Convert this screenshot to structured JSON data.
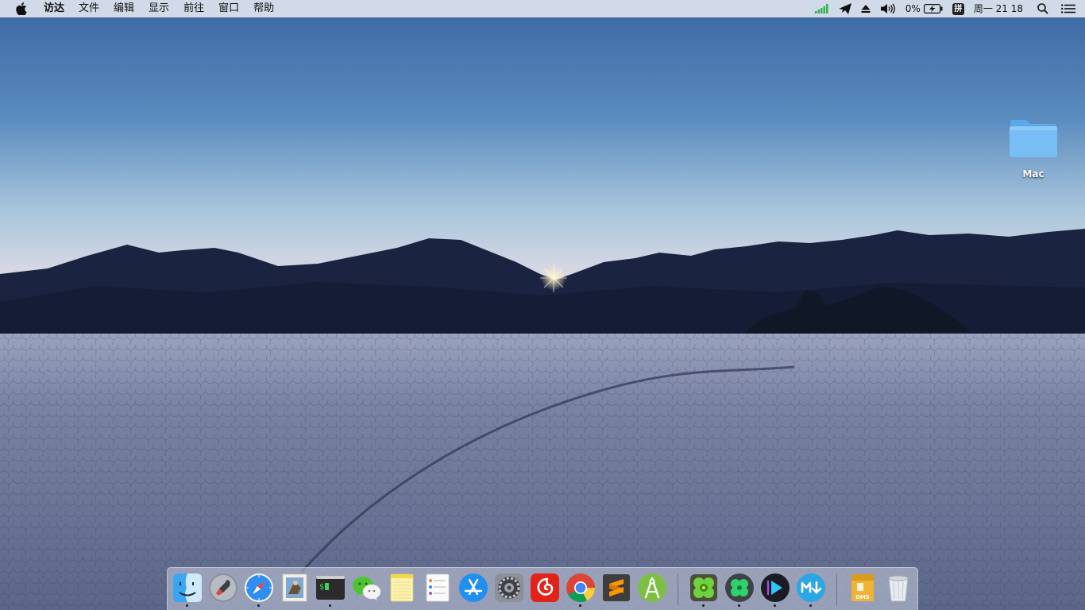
{
  "menubar": {
    "app_menu": "访达",
    "menus": [
      "文件",
      "编辑",
      "显示",
      "前往",
      "窗口",
      "帮助"
    ],
    "status": {
      "battery_percent": "0%",
      "input_method": "拼",
      "clock": "周一 21 18"
    }
  },
  "desktop": {
    "folder_label": "Mac"
  },
  "dock": {
    "apps": [
      {
        "icon": "finder-icon",
        "running": true
      },
      {
        "icon": "launchpad-icon",
        "running": false
      },
      {
        "icon": "safari-icon",
        "running": true
      },
      {
        "icon": "mail-stamp-icon",
        "running": false
      },
      {
        "icon": "terminal-icon",
        "running": true
      },
      {
        "icon": "wechat-icon",
        "running": false
      },
      {
        "icon": "notes-icon",
        "running": false
      },
      {
        "icon": "reminders-icon",
        "running": false
      },
      {
        "icon": "app-store-icon",
        "running": false
      },
      {
        "icon": "system-preferences-icon",
        "running": false
      },
      {
        "icon": "netease-music-icon",
        "running": false
      },
      {
        "icon": "chrome-icon",
        "running": true
      },
      {
        "icon": "sublime-text-icon",
        "running": false
      },
      {
        "icon": "android-studio-icon",
        "running": false
      },
      {
        "icon": "green-clover-icon",
        "running": true
      },
      {
        "icon": "green-clover-round-icon",
        "running": true
      },
      {
        "icon": "media-player-icon",
        "running": true
      },
      {
        "icon": "markdown-icon",
        "running": true
      },
      {
        "icon": "dmg-archive-icon",
        "running": false
      },
      {
        "icon": "trash-icon",
        "running": false
      }
    ],
    "dmg_label": "DMS"
  },
  "colors": {
    "sky_top": "#3c6aa6",
    "sky_horizon": "#f3e3ea",
    "mountains": "#19233a",
    "playa": "#6d7696",
    "folder_blue": "#72b8f2"
  }
}
